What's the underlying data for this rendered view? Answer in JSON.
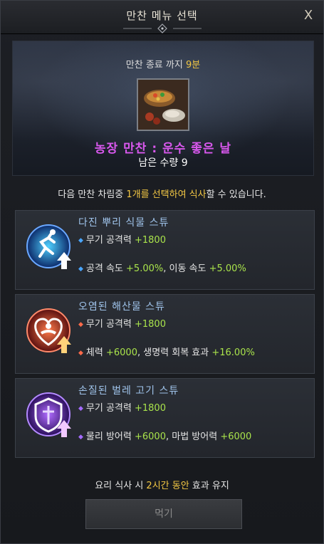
{
  "window": {
    "title": "만찬 메뉴 선택",
    "close_label": "X"
  },
  "hero": {
    "timer_prefix": "만찬 종료 까지 ",
    "timer_value": "9분",
    "dish_name": "농장 만찬 : 운수 좋은 날",
    "remaining": "남은 수량 9"
  },
  "instruction": {
    "before": "다음 만찬 차림중 ",
    "highlight": "1개를 선택하여 식사",
    "after": "할 수 있습니다."
  },
  "options": [
    {
      "name": "다진 뿌리 식물 스튜",
      "line1_label": "무기 공격력 ",
      "line1_value": "+1800",
      "line2_a": "공격 속도 ",
      "line2_b": "+5.00%",
      "line2_c": ", 이동 속도 ",
      "line2_d": "+5.00%",
      "accent": "#4aa6ff"
    },
    {
      "name": "오염된 해산물 스튜",
      "line1_label": "무기 공격력 ",
      "line1_value": "+1800",
      "line2_a": "체력 ",
      "line2_b": "+6000",
      "line2_c": ", 생명력 회복 효과 ",
      "line2_d": "+16.00%",
      "accent": "#ff6a4a"
    },
    {
      "name": "손질된 벌레 고기 스튜",
      "line1_label": "무기 공격력 ",
      "line1_value": "+1800",
      "line2_a": "물리 방어력 ",
      "line2_b": "+6000",
      "line2_c": ", 마법 방어력 ",
      "line2_d": "+6000",
      "accent": "#a46bff"
    }
  ],
  "footer": {
    "before": "요리 식사 시 ",
    "highlight": "2시간 동안",
    "after": " 효과 유지",
    "button": "먹기"
  },
  "colors": {
    "highlight": "#f2c744",
    "value": "#a9e34b",
    "dish_name": "#d958ee",
    "option_name": "#9fc3ea"
  }
}
